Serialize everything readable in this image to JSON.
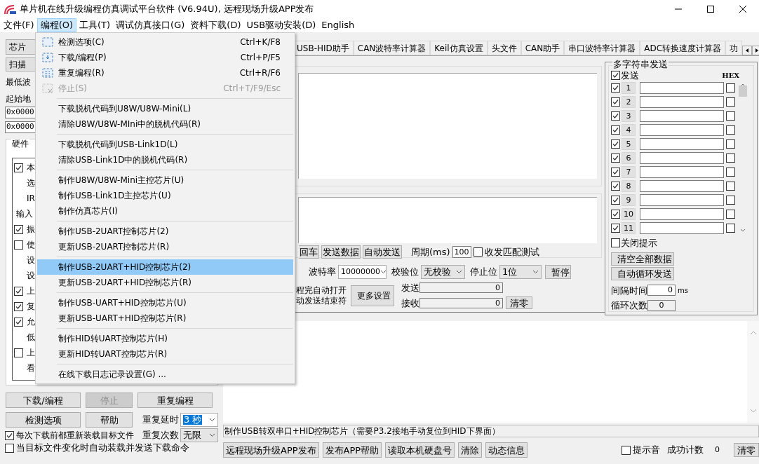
{
  "window": {
    "title": "单片机在线升级编程仿真调试平台软件 (V6.94U), 远程现场升级APP发布"
  },
  "menu_bar": [
    {
      "label": "文件(F)",
      "selected": false
    },
    {
      "label": "编程(O)",
      "selected": true
    },
    {
      "label": "工具(T)",
      "selected": false
    },
    {
      "label": "调试仿真接口(G)",
      "selected": false
    },
    {
      "label": "资料下载(D)",
      "selected": false
    },
    {
      "label": "USB驱动安装(D)",
      "selected": false
    },
    {
      "label": "English",
      "selected": false
    }
  ],
  "dropdown": {
    "groups": [
      [
        {
          "label": "检测选项(C)",
          "shortcut": "Ctrl+K/F8",
          "disabled": false,
          "selected": false
        },
        {
          "label": "下载/编程(P)",
          "shortcut": "Ctrl+P/F5",
          "disabled": false,
          "selected": false
        },
        {
          "label": "重复编程(R)",
          "shortcut": "Ctrl+R/F6",
          "disabled": false,
          "selected": false
        },
        {
          "label": "停止(S)",
          "shortcut": "Ctrl+T/F9/Esc",
          "disabled": true,
          "selected": false
        }
      ],
      [
        {
          "label": "下载脱机代码到U8W/U8W-Mini(L)",
          "disabled": false,
          "selected": false
        },
        {
          "label": "清除U8W/U8W-MIni中的脱机代码(R)",
          "disabled": false,
          "selected": false
        }
      ],
      [
        {
          "label": "下载脱机代码到USB-Link1D(L)",
          "disabled": false,
          "selected": false
        },
        {
          "label": "清除USB-Link1D中的脱机代码(R)",
          "disabled": false,
          "selected": false
        }
      ],
      [
        {
          "label": "制作U8W/U8W-Mini主控芯片(U)",
          "disabled": false,
          "selected": false
        },
        {
          "label": "制作USB-Link1D主控芯片(U)",
          "disabled": false,
          "selected": false
        },
        {
          "label": "制作仿真芯片(I)",
          "disabled": false,
          "selected": false
        }
      ],
      [
        {
          "label": "制作USB-2UART控制芯片(2)",
          "disabled": false,
          "selected": false
        },
        {
          "label": "更新USB-2UART控制芯片(R)",
          "disabled": false,
          "selected": false
        }
      ],
      [
        {
          "label": "制作USB-2UART+HID控制芯片(2)",
          "disabled": false,
          "selected": true
        },
        {
          "label": "更新USB-2UART+HID控制芯片(R)",
          "disabled": false,
          "selected": false
        }
      ],
      [
        {
          "label": "制作USB-UART+HID控制芯片(U)",
          "disabled": false,
          "selected": false
        },
        {
          "label": "更新USB-UART+HID控制芯片(R)",
          "disabled": false,
          "selected": false
        }
      ],
      [
        {
          "label": "制作HID转UART控制芯片(H)",
          "disabled": false,
          "selected": false
        },
        {
          "label": "更新HID转UART控制芯片(R)",
          "disabled": false,
          "selected": false
        }
      ],
      [
        {
          "label": "在线下载日志记录设置(G) ...",
          "disabled": false,
          "selected": false
        }
      ]
    ]
  },
  "left_panel": {
    "chip_button": "芯片",
    "scan_button": "扫描",
    "min_baud_label": "最低波",
    "start_addr_label": "起始地",
    "addr_fields": [
      "0x0000",
      "0x0000"
    ],
    "hardware_group": {
      "title": "硬件",
      "rows": [
        {
          "kind": "checkbox",
          "label": "本",
          "checked": true
        },
        {
          "kind": "indent",
          "label": "选"
        },
        {
          "kind": "indent",
          "label": "IR"
        },
        {
          "kind": "heading",
          "label": "输入"
        },
        {
          "kind": "checkbox",
          "label": "振",
          "checked": true
        },
        {
          "kind": "checkbox",
          "label": "使",
          "checked": false
        },
        {
          "kind": "indent",
          "label": "设"
        },
        {
          "kind": "indent",
          "label": "设"
        },
        {
          "kind": "checkbox",
          "label": "上",
          "checked": true
        },
        {
          "kind": "checkbox",
          "label": "复",
          "checked": true
        },
        {
          "kind": "checkbox",
          "label": "允",
          "checked": true
        },
        {
          "kind": "indent",
          "label": "低"
        },
        {
          "kind": "checkbox",
          "label": "上",
          "checked": false
        },
        {
          "kind": "indent",
          "label": "看"
        }
      ]
    },
    "action_buttons": [
      {
        "label": "下载/编程",
        "disabled": false
      },
      {
        "label": "停止",
        "disabled": true
      },
      {
        "label": "重复编程",
        "disabled": false
      },
      {
        "label": "检测选项",
        "disabled": false
      },
      {
        "label": "帮助",
        "disabled": false
      }
    ],
    "repeat_delay": {
      "label": "重复延时",
      "value": "3 秒"
    },
    "repeat_count": {
      "label": "重复次数",
      "value": "无限"
    },
    "options": [
      {
        "label": "每次下载前都重新装载目标文件",
        "checked": true
      },
      {
        "label": "当目标文件变化时自动装载并发送下载命令",
        "checked": false
      }
    ]
  },
  "tabs": [
    {
      "label": "USB-HID助手",
      "selected": false
    },
    {
      "label": "CAN波特率计算器",
      "selected": false
    },
    {
      "label": "Keil仿真设置",
      "selected": false
    },
    {
      "label": "头文件",
      "selected": false
    },
    {
      "label": "CAN助手",
      "selected": false
    },
    {
      "label": "串口波特率计算器",
      "selected": false
    },
    {
      "label": "ADC转换速度计算器",
      "selected": false
    },
    {
      "label": "功",
      "selected": false
    }
  ],
  "serial": {
    "send_buttons": [
      "回车",
      "发送数据",
      "自动发送"
    ],
    "period_label": "周期(ms)",
    "period_value": "100",
    "match_test": {
      "label": "收发匹配测试",
      "checked": false
    },
    "baud": {
      "label": "波特率",
      "value": "10000000"
    },
    "parity": {
      "label": "校验位",
      "value": "无校验"
    },
    "stop_bits": {
      "label": "停止位",
      "value": "1位"
    },
    "pause_button": "暂停",
    "auto_labels": [
      "程完自动打开",
      "动发送结束符"
    ],
    "more_button": "更多设置",
    "send": {
      "label": "发送",
      "value": "0"
    },
    "receive": {
      "label": "接收",
      "value": "0"
    },
    "clear_button": "清零"
  },
  "multi_send": {
    "title": "多字符串发送",
    "send_all": {
      "label": "发送",
      "checked": true
    },
    "hex_label": "HEX",
    "rows": [
      {
        "number": "1",
        "checked": true,
        "hex": false
      },
      {
        "number": "2",
        "checked": true,
        "hex": false
      },
      {
        "number": "3",
        "checked": true,
        "hex": false
      },
      {
        "number": "4",
        "checked": true,
        "hex": false
      },
      {
        "number": "5",
        "checked": true,
        "hex": false
      },
      {
        "number": "6",
        "checked": true,
        "hex": false
      },
      {
        "number": "7",
        "checked": true,
        "hex": false
      },
      {
        "number": "8",
        "checked": true,
        "hex": false
      },
      {
        "number": "9",
        "checked": true,
        "hex": false
      },
      {
        "number": "10",
        "checked": true,
        "hex": false
      },
      {
        "number": "11",
        "checked": true,
        "hex": false
      }
    ],
    "close_hint": {
      "label": "关闭提示",
      "checked": false
    },
    "buttons": [
      "清空全部数据",
      "自动循环发送"
    ],
    "interval": {
      "label": "间隔时间",
      "value": "0",
      "unit": "ms"
    },
    "loop_count": {
      "label": "循环次数",
      "value": "0"
    }
  },
  "status_text": "制作USB转双串口+HID控制芯片（需要P3.2接地手动复位到HID下界面）",
  "bottom_bar": {
    "buttons": [
      "远程现场升级APP发布",
      "发布APP帮助",
      "读取本机硬盘号",
      "清除",
      "动态信息"
    ],
    "sound": {
      "label": "提示音",
      "checked": false
    },
    "success_label": "成功计数",
    "success_value": "0",
    "clear_button": "清零"
  }
}
